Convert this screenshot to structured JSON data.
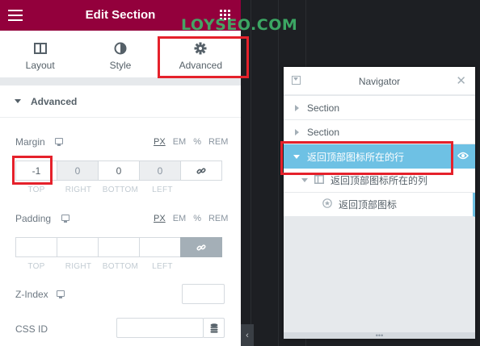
{
  "panel": {
    "title": "Edit Section",
    "tabs": [
      {
        "label": "Layout",
        "icon": "layout-icon"
      },
      {
        "label": "Style",
        "icon": "style-icon"
      },
      {
        "label": "Advanced",
        "icon": "gear-icon"
      }
    ],
    "section_heading": "Advanced",
    "margin": {
      "label": "Margin",
      "units": [
        "PX",
        "EM",
        "%",
        "REM"
      ],
      "selected_unit": "PX",
      "values": {
        "top": "-1",
        "right": "0",
        "bottom": "0",
        "left": "0"
      },
      "dim_labels": [
        "TOP",
        "RIGHT",
        "BOTTOM",
        "LEFT"
      ]
    },
    "padding": {
      "label": "Padding",
      "units": [
        "PX",
        "EM",
        "%",
        "REM"
      ],
      "selected_unit": "PX",
      "dim_labels": [
        "TOP",
        "RIGHT",
        "BOTTOM",
        "LEFT"
      ]
    },
    "z_index_label": "Z-Index",
    "css_id_label": "CSS ID"
  },
  "watermark": "LOYSEO.COM",
  "navigator": {
    "title": "Navigator",
    "items": [
      {
        "label": "Section"
      },
      {
        "label": "Section"
      },
      {
        "label": "返回顶部图标所在的行"
      },
      {
        "label": "返回顶部图标所在的列"
      },
      {
        "label": "返回顶部图标"
      }
    ]
  },
  "colors": {
    "header": "#93003c",
    "selected_row": "#6ec1e4",
    "highlight": "#e5212b",
    "watermark": "#3fb56a"
  }
}
